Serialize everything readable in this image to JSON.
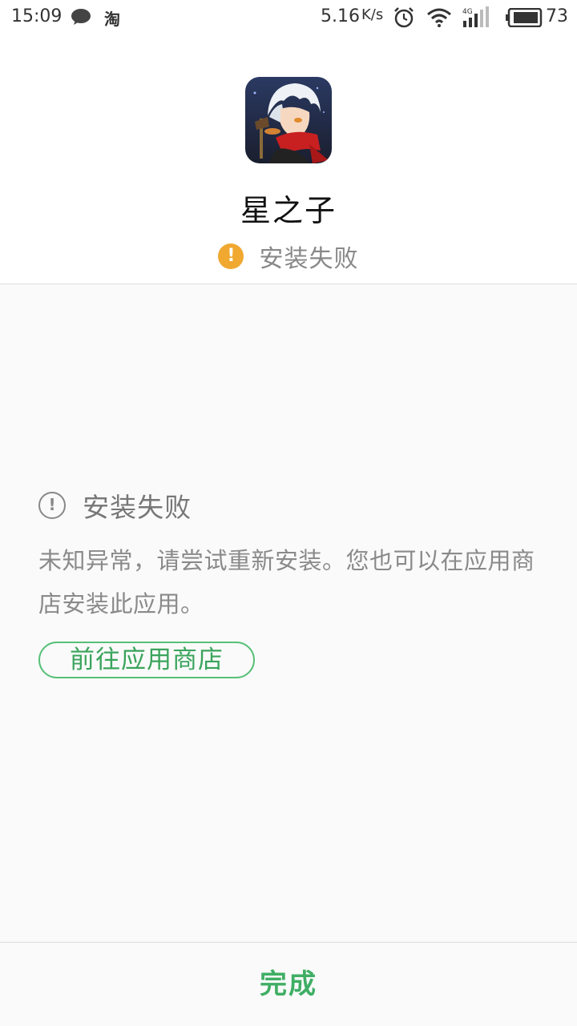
{
  "status_bar": {
    "time": "15:09",
    "notification_icons": [
      "message-icon",
      "taobao-icon"
    ],
    "taobao_label": "淘",
    "net_speed": "5.16",
    "net_speed_unit": "K/s",
    "network_type": "4G",
    "battery_level": "73",
    "icons": [
      "alarm-icon",
      "wifi-icon",
      "signal-icon",
      "battery-icon"
    ]
  },
  "app": {
    "name": "星之子",
    "icon": "app-icon-game-character",
    "install_status": "安装失败",
    "status_icon": "warning-icon",
    "status_color": "#f0a830"
  },
  "error": {
    "title": "安装失败",
    "icon": "warning-outline-icon",
    "description": "未知异常，请尝试重新安装。您也可以在应用商店安装此应用。",
    "store_button_label": "前往应用商店",
    "accent_color": "#3fae64"
  },
  "footer": {
    "done_label": "完成"
  }
}
